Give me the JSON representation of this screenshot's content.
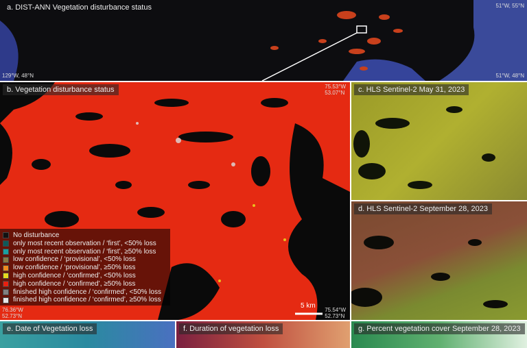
{
  "panel_a": {
    "title": "a. DIST-ANN Vegetation disturbance status",
    "ne": "51°W, 55°N",
    "sw": "129°W, 48°N",
    "se": "51°W, 48°N"
  },
  "panel_b": {
    "title": "b. Vegetation disturbance status",
    "ne_lon": "75.53°W",
    "ne_lat": "53.07°N",
    "sw_lon": "76.36°W",
    "sw_lat": "52.73°N",
    "se_lon": "75.54°W",
    "se_lat": "52.73°N",
    "scale": "5 km",
    "legend": [
      {
        "label": "No disturbance",
        "color": "#111111"
      },
      {
        "label": "only most recent observation / ‘first’, <50% loss",
        "color": "#0e5a5a"
      },
      {
        "label": "only most recent observation / ‘first’, ≥50% loss",
        "color": "#1aa0a0"
      },
      {
        "label": "low confidence / ‘provisional’, <50% loss",
        "color": "#8a7a45"
      },
      {
        "label": "low confidence / ‘provisional’, ≥50% loss",
        "color": "#f08a20"
      },
      {
        "label": "high confidence / ‘confirmed’, <50% loss",
        "color": "#e6d820"
      },
      {
        "label": "high confidence / ‘confirmed’, ≥50% loss",
        "color": "#e82010"
      },
      {
        "label": "finished high confidence / ‘confirmed’, <50% loss",
        "color": "#808080"
      },
      {
        "label": "finished high confidence / ‘confirmed’, ≥50% loss",
        "color": "#e6e6e6"
      }
    ]
  },
  "panel_c": {
    "title": "c. HLS Sentinel-2 May 31, 2023"
  },
  "panel_d": {
    "title": "d. HLS Sentinel-2 September 28, 2023"
  },
  "panel_e": {
    "title": "e. Date of Vegetation loss"
  },
  "panel_f": {
    "title": "f. Duration of vegetation loss"
  },
  "panel_g": {
    "title": "g. Percent vegetation cover September 28, 2023"
  }
}
